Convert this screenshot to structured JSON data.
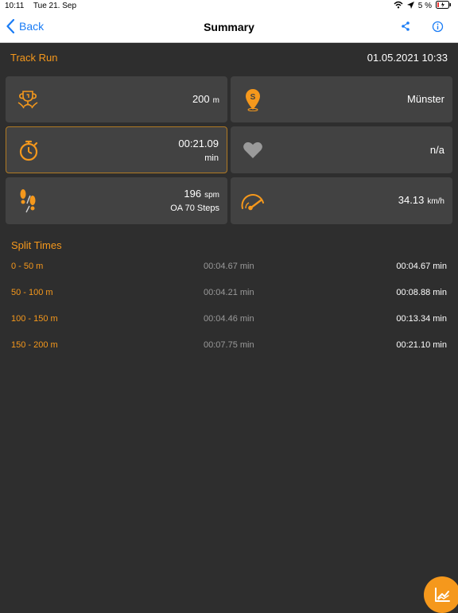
{
  "status_bar": {
    "time": "10:11",
    "date": "Tue 21. Sep",
    "battery_percent": "5 %"
  },
  "nav": {
    "back_label": "Back",
    "title": "Summary"
  },
  "run": {
    "type": "Track Run",
    "datetime": "01.05.2021 10:33"
  },
  "stats": {
    "distance": {
      "value": "200",
      "unit": "m",
      "icon": "trophy-icon"
    },
    "location": {
      "value": "Münster",
      "icon": "location-pin-icon"
    },
    "time": {
      "value": "00:21.09",
      "unit": "min",
      "icon": "stopwatch-icon"
    },
    "heart_rate": {
      "value": "n/a",
      "icon": "heart-icon"
    },
    "cadence": {
      "value": "196",
      "unit": "spm",
      "shoe": "OA 70 Steps",
      "icon": "footsteps-icon"
    },
    "speed": {
      "value": "34.13",
      "unit": "km/h",
      "icon": "speedometer-icon"
    }
  },
  "splits": {
    "title": "Split Times",
    "rows": [
      {
        "range": "0 - 50 m",
        "lap": "00:04.67 min",
        "total": "00:04.67 min"
      },
      {
        "range": "50 - 100 m",
        "lap": "00:04.21 min",
        "total": "00:08.88 min"
      },
      {
        "range": "100 - 150 m",
        "lap": "00:04.46 min",
        "total": "00:13.34 min"
      },
      {
        "range": "150 - 200 m",
        "lap": "00:07.75 min",
        "total": "00:21.10 min"
      }
    ]
  },
  "colors": {
    "accent": "#f5981c",
    "link": "#1a7cf5",
    "background": "#2e2e2e",
    "card": "#424242"
  }
}
